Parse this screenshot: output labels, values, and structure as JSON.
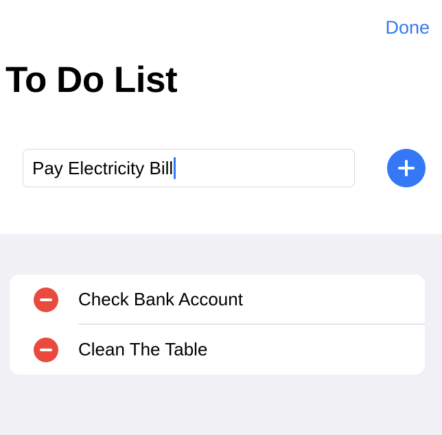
{
  "header": {
    "done_label": "Done",
    "title": "To Do List"
  },
  "input": {
    "value": "Pay Electricity Bill"
  },
  "add_button": {
    "icon": "plus-icon"
  },
  "list": {
    "items": [
      {
        "label": "Check Bank Account",
        "icon": "minus-icon"
      },
      {
        "label": "Clean The Table",
        "icon": "minus-icon"
      }
    ]
  },
  "colors": {
    "accent": "#3478f6",
    "delete": "#ea4a3d",
    "grouped_background": "#f0f0f5"
  }
}
